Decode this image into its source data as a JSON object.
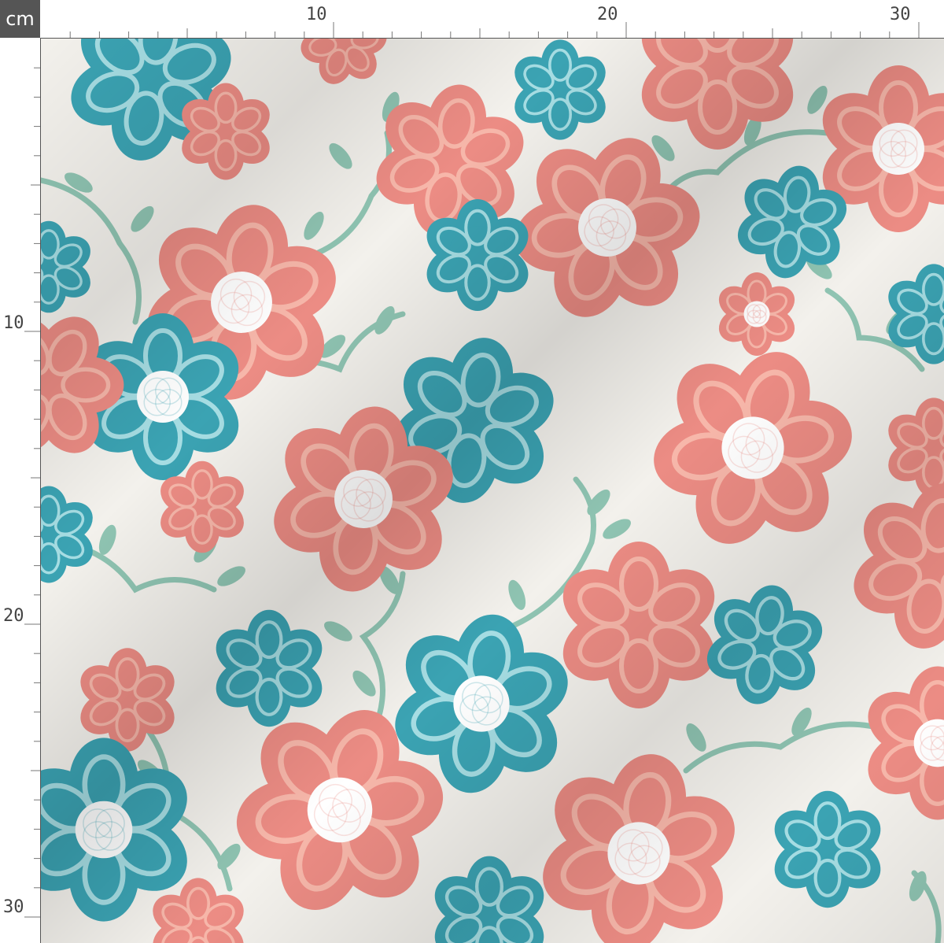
{
  "ruler": {
    "unit": "cm",
    "top_labels": [
      "10",
      "20",
      "30"
    ],
    "left_labels": [
      "10",
      "20",
      "30"
    ],
    "major_every": 10,
    "visible_range_cm": 31
  },
  "pattern": {
    "background": "#f3f1ec",
    "coral": "#ec8c84",
    "coral_line": "#f7b7aa",
    "teal": "#3ba3b3",
    "teal_line": "#a6dde3",
    "leaf": "#8fc4b2",
    "center": "#ffffff"
  },
  "icons": {
    "coral_flower": "coral-flower-icon",
    "teal_flower": "teal-flower-icon",
    "leaf_vine": "leaf-vine-icon"
  }
}
